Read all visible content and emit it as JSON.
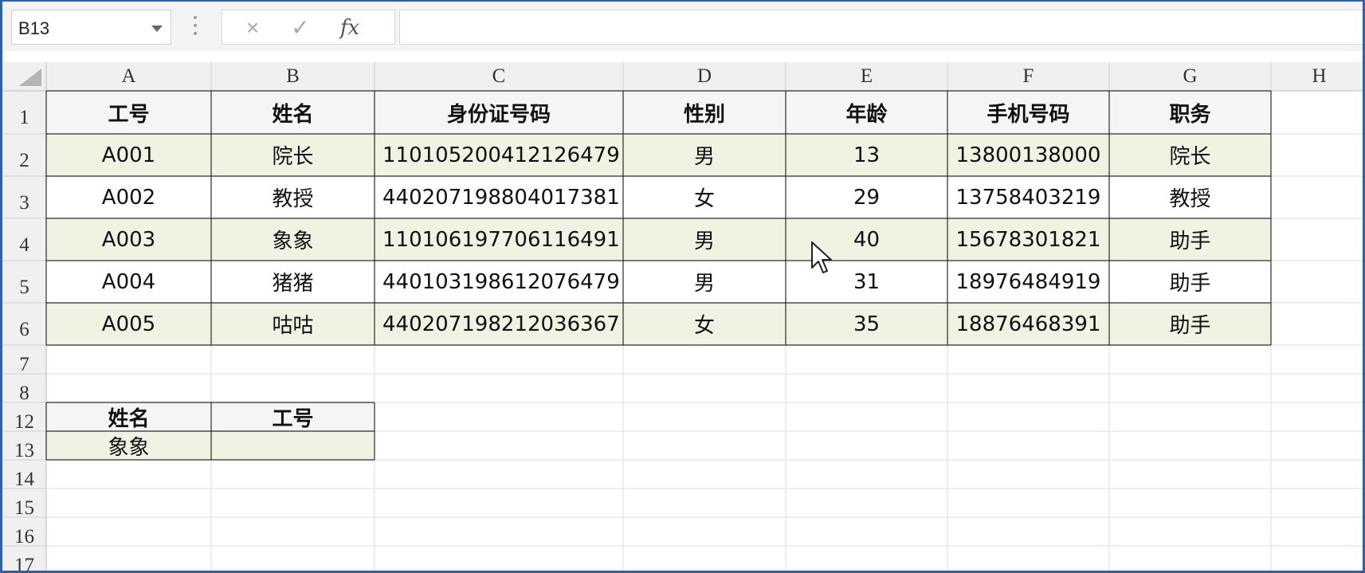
{
  "namebox": {
    "value": "B13"
  },
  "formula_bar": {
    "cancel_icon": "×",
    "enter_icon": "✓",
    "fx_label": "fx",
    "formula": ""
  },
  "columns": [
    "A",
    "B",
    "C",
    "D",
    "E",
    "F",
    "G",
    "H"
  ],
  "rows": [
    "1",
    "2",
    "3",
    "4",
    "5",
    "6",
    "7",
    "8",
    "12",
    "13",
    "14",
    "15",
    "16",
    "17"
  ],
  "table": {
    "headers": [
      "工号",
      "姓名",
      "身份证号码",
      "性别",
      "年龄",
      "手机号码",
      "职务"
    ],
    "records": [
      [
        "A001",
        "院长",
        "110105200412126479",
        "男",
        "13",
        "13800138000",
        "院长"
      ],
      [
        "A002",
        "教授",
        "440207198804017381",
        "女",
        "29",
        "13758403219",
        "教授"
      ],
      [
        "A003",
        "象象",
        "110106197706116491",
        "男",
        "40",
        "15678301821",
        "助手"
      ],
      [
        "A004",
        "猪猪",
        "440103198612076479",
        "男",
        "31",
        "18976484919",
        "助手"
      ],
      [
        "A005",
        "咕咕",
        "440207198212036367",
        "女",
        "35",
        "18876468391",
        "助手"
      ]
    ]
  },
  "lookup": {
    "headers": [
      "姓名",
      "工号"
    ],
    "values": [
      "象象",
      ""
    ]
  },
  "colors": {
    "band": "#eef3e2",
    "header_fill": "#f2f2f2",
    "border": "#2b2b2b",
    "gridline": "#dedede",
    "accent": "#2f5fa6"
  }
}
